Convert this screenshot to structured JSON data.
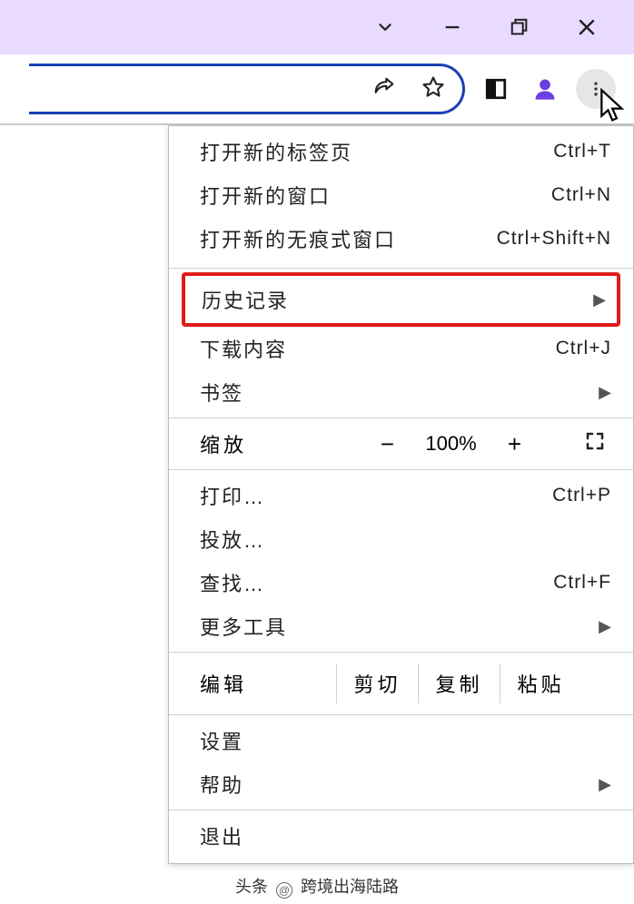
{
  "window_controls": {
    "dropdown": "⌄",
    "minimize": "—",
    "maximize": "❐",
    "close": "✕"
  },
  "toolbar": {
    "share": "share-icon",
    "bookmark": "star-icon",
    "reader": "reader-icon",
    "profile": "profile-icon",
    "menu": "kebab-icon"
  },
  "menu": {
    "new_tab": {
      "label": "打开新的标签页",
      "shortcut": "Ctrl+T"
    },
    "new_window": {
      "label": "打开新的窗口",
      "shortcut": "Ctrl+N"
    },
    "new_incognito": {
      "label": "打开新的无痕式窗口",
      "shortcut": "Ctrl+Shift+N"
    },
    "history": {
      "label": "历史记录",
      "submenu": true
    },
    "downloads": {
      "label": "下载内容",
      "shortcut": "Ctrl+J"
    },
    "bookmarks": {
      "label": "书签",
      "submenu": true
    },
    "zoom": {
      "label": "缩放",
      "value": "100%",
      "minus": "−",
      "plus": "+"
    },
    "print": {
      "label": "打印…",
      "shortcut": "Ctrl+P"
    },
    "cast": {
      "label": "投放…"
    },
    "find": {
      "label": "查找…",
      "shortcut": "Ctrl+F"
    },
    "more_tools": {
      "label": "更多工具",
      "submenu": true
    },
    "edit": {
      "label": "编辑",
      "cut": "剪切",
      "copy": "复制",
      "paste": "粘贴"
    },
    "settings": {
      "label": "设置"
    },
    "help": {
      "label": "帮助",
      "submenu": true
    },
    "exit": {
      "label": "退出"
    }
  },
  "watermark": "跨境出海陆路",
  "footer": {
    "prefix": "头条",
    "author": "跨境出海陆路"
  }
}
